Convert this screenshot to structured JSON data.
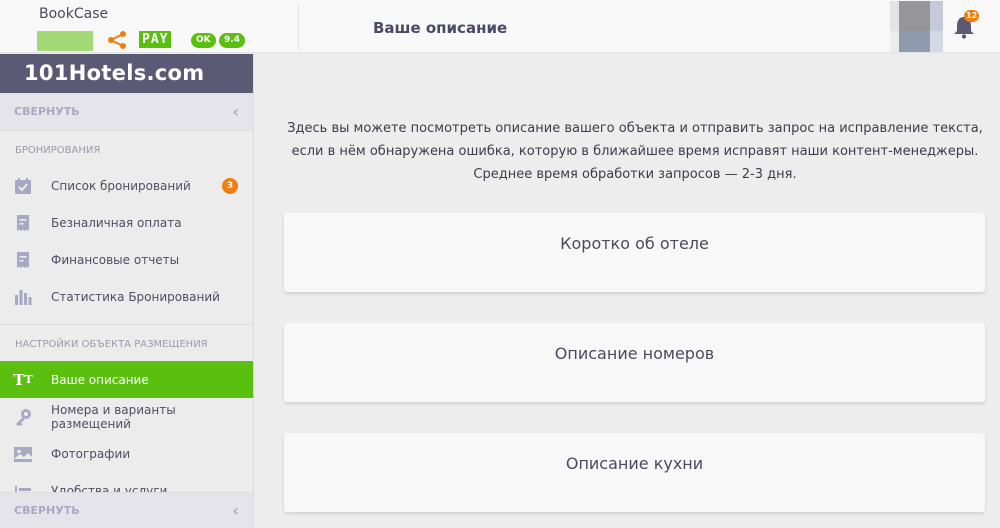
{
  "header": {
    "brand_name": "BookCase",
    "pay_label": "PAY",
    "ok_label": "OK",
    "rating": "9.4",
    "page_title": "Ваше описание",
    "notifications_count": "12",
    "icons": {
      "share": "share-icon",
      "bell": "bell-icon"
    }
  },
  "sidebar": {
    "logo_text": "101Hotels.com",
    "collapse_label": "СВЕРНУТЬ",
    "sections": [
      {
        "title": "БРОНИРОВАНИЯ",
        "items": [
          {
            "label": "Список бронирований",
            "icon": "calendar-check-icon",
            "badge": "3"
          },
          {
            "label": "Безналичная оплата",
            "icon": "receipt-icon"
          },
          {
            "label": "Финансовые отчеты",
            "icon": "receipt-icon"
          },
          {
            "label": "Статистика Бронирований",
            "icon": "bar-chart-icon"
          }
        ]
      },
      {
        "title": "НАСТРОЙКИ ОБЪЕКТА РАЗМЕЩЕНИЯ",
        "items": [
          {
            "label": "Ваше описание",
            "icon": "text-format-icon",
            "active": true
          },
          {
            "label": "Номера и варианты размещений",
            "icon": "key-icon"
          },
          {
            "label": "Фотографии",
            "icon": "image-icon"
          },
          {
            "label": "Удобства и услуги",
            "icon": "amenities-icon"
          }
        ]
      }
    ],
    "bottom_collapse_label": "СВЕРНУТЬ"
  },
  "main": {
    "intro_lines": [
      "Здесь вы можете посмотреть описание вашего объекта и отправить запрос на исправление текста,",
      "если в нём обнаружена ошибка, которую в ближайшее время исправят наши контент-менеджеры.",
      "Среднее время обработки запросов — 2-3 дня."
    ],
    "cards": [
      {
        "title": "Коротко об отеле"
      },
      {
        "title": "Описание номеров"
      },
      {
        "title": "Описание кухни"
      }
    ]
  },
  "colors": {
    "accent_green": "#5bbf10",
    "badge_orange": "#f07d0c",
    "sidebar_logo_bg": "#5b5a75",
    "icon_muted": "#a9a8c2"
  }
}
